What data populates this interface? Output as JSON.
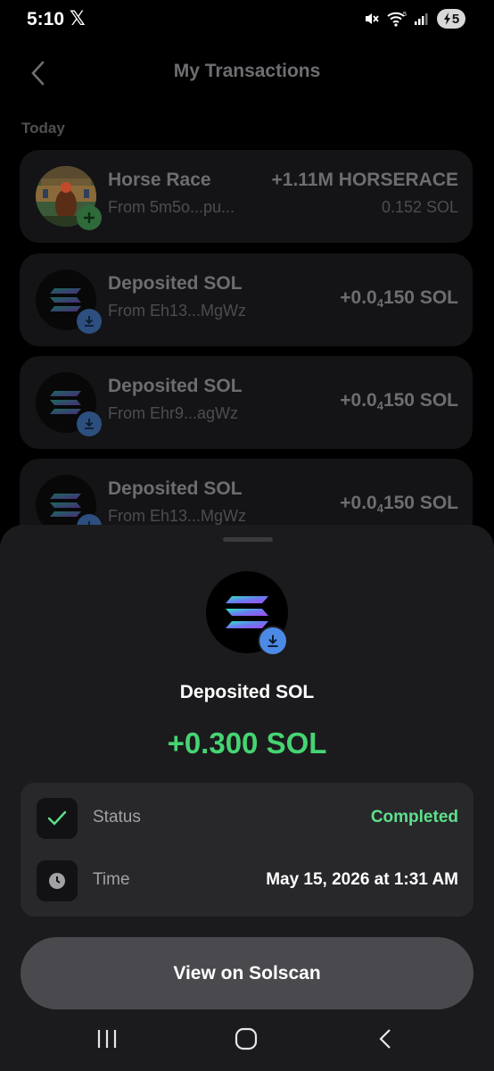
{
  "status_bar": {
    "time": "5:10",
    "x_logo": "𝕏",
    "battery": "5"
  },
  "header": {
    "title": "My Transactions"
  },
  "section": {
    "label": "Today"
  },
  "transactions": [
    {
      "title": "Horse Race",
      "subtitle": "From 5m5o...pu...",
      "amount": "+1.11M HORSERACE",
      "amount_sub": "0.152 SOL",
      "badge": "plus-icon"
    },
    {
      "title": "Deposited SOL",
      "subtitle": "From Eh13...MgWz",
      "amount_prefix": "+0.0",
      "amount_subscript": "4",
      "amount_suffix": "150 SOL",
      "badge": "download-icon"
    },
    {
      "title": "Deposited SOL",
      "subtitle": "From Ehr9...agWz",
      "amount_prefix": "+0.0",
      "amount_subscript": "4",
      "amount_suffix": "150 SOL",
      "badge": "download-icon"
    },
    {
      "title": "Deposited SOL",
      "subtitle": "From Eh13...MgWz",
      "amount_prefix": "+0.0",
      "amount_subscript": "4",
      "amount_suffix": "150 SOL",
      "badge": "download-icon"
    }
  ],
  "sheet": {
    "title": "Deposited SOL",
    "amount": "+0.300 SOL",
    "details": {
      "status_label": "Status",
      "status_value": "Completed",
      "time_label": "Time",
      "time_value": "May 15, 2026 at 1:31 AM"
    },
    "button_label": "View on Solscan"
  },
  "colors": {
    "positive": "#46d473",
    "completed": "#5fe08b",
    "badge_blue": "#4b8be6"
  }
}
